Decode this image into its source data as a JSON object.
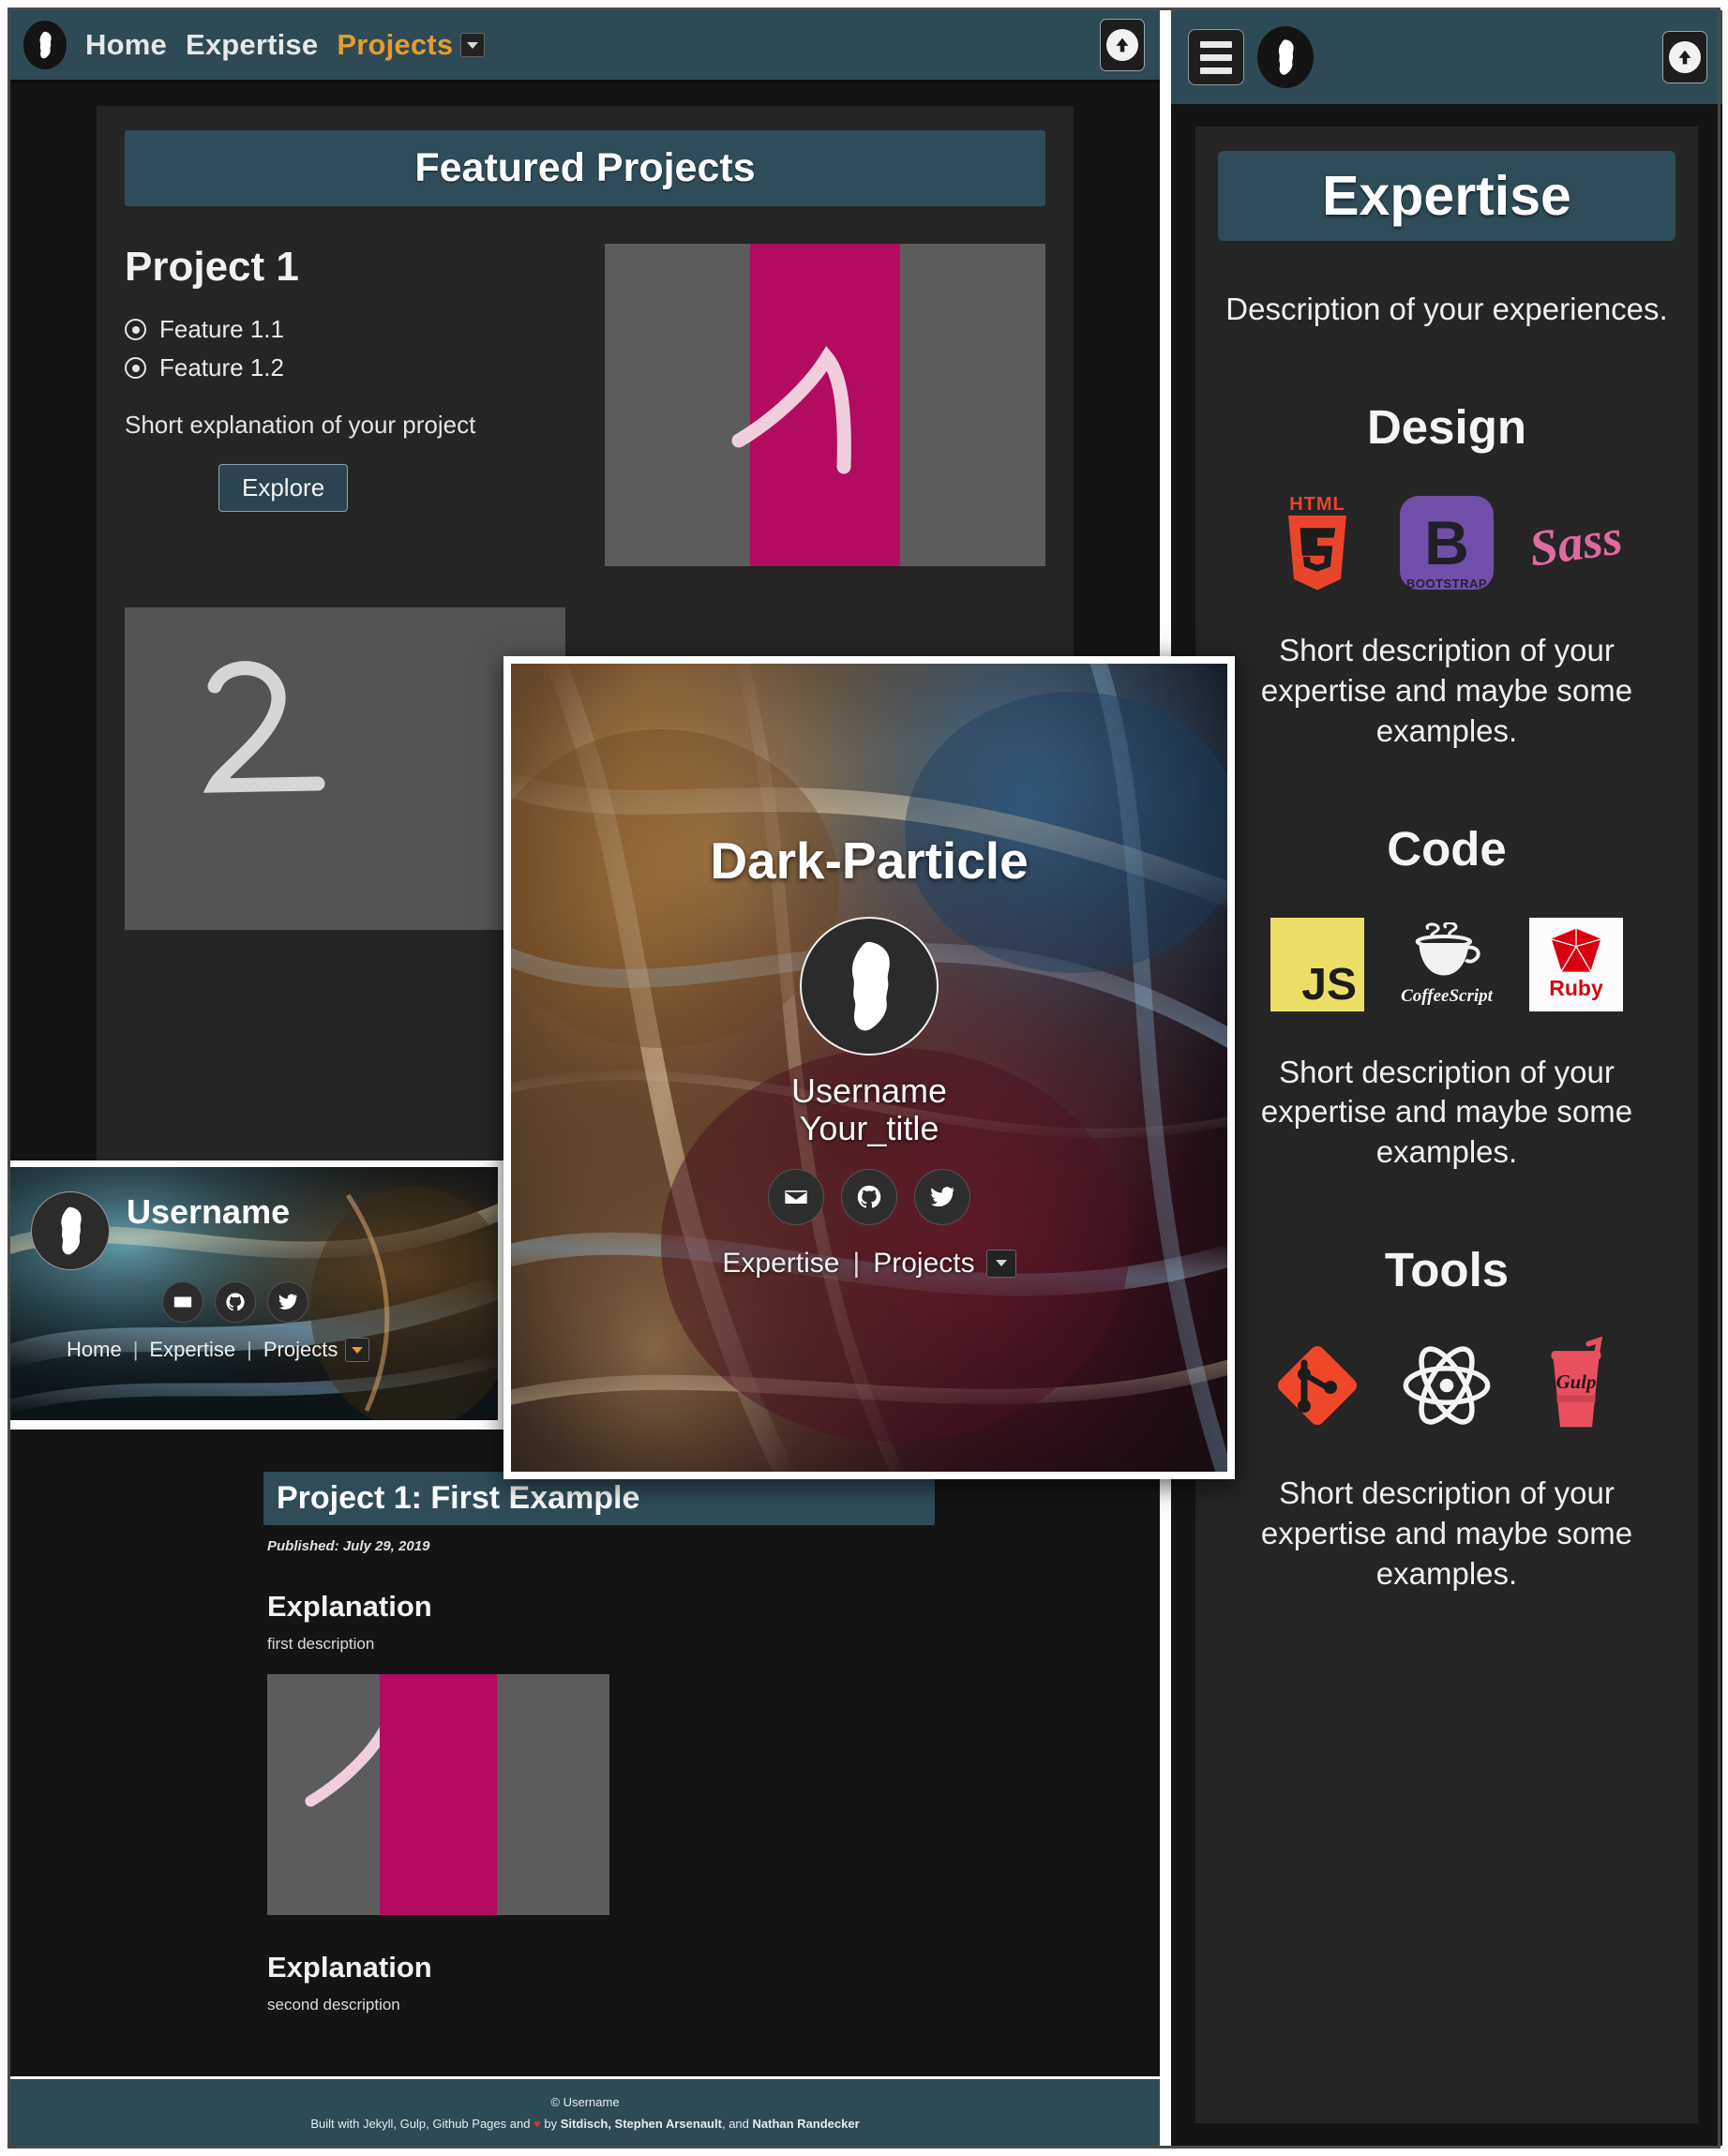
{
  "left_panel": {
    "nav": {
      "brand_icon": "avatar-blob-icon",
      "items": [
        {
          "label": "Home",
          "active": false
        },
        {
          "label": "Expertise",
          "active": false
        },
        {
          "label": "Projects",
          "active": true
        }
      ],
      "projects_caret": "chevron-down-icon",
      "scroll_top_icon": "arrow-up-icon"
    },
    "banner": "Featured Projects",
    "project": {
      "title": "Project 1",
      "features": [
        "Feature 1.1",
        "Feature 1.2"
      ],
      "description": "Short explanation of your project",
      "explore_label": "Explore",
      "thumb_digit": "1",
      "thumb_band_color": "#b30b5f"
    },
    "project2": {
      "thumb_digit": "2"
    }
  },
  "mobile_card": {
    "username": "Username",
    "socials": [
      "email-icon",
      "github-icon",
      "twitter-icon"
    ],
    "nav": [
      "Home",
      "Expertise",
      "Projects"
    ],
    "caret": "chevron-down-icon"
  },
  "modal": {
    "title": "Dark-Particle",
    "avatar_icon": "avatar-blob-icon",
    "username": "Username",
    "subtitle": "Your_title",
    "socials": [
      "email-icon",
      "github-icon",
      "twitter-icon"
    ],
    "nav": [
      "Expertise",
      "Projects"
    ],
    "caret": "chevron-down-icon"
  },
  "post_panel": {
    "banner": "Project 1: First Example",
    "published": "Published: July 29, 2019",
    "sections": [
      {
        "heading": "Explanation",
        "body": "first description"
      },
      {
        "heading": "Explanation",
        "body": "second description"
      }
    ],
    "thumb_digit": "1"
  },
  "footer": {
    "copyright": "© Username",
    "credit_prefix": "Built with Jekyll, Gulp, Github Pages and",
    "heart": "♥",
    "credit_by": "by",
    "credit_names_1": "Sitdisch, Stephen Arsenault",
    "credit_and": "and",
    "credit_names_2": "Nathan Randecker"
  },
  "right_panel": {
    "nav": {
      "menu_icon": "hamburger-menu-icon",
      "brand_icon": "avatar-blob-icon",
      "scroll_top_icon": "arrow-up-icon"
    },
    "banner": "Expertise",
    "description": "Description of your experiences.",
    "sections": [
      {
        "heading": "Design",
        "icons": [
          "html5-icon",
          "bootstrap-icon",
          "sass-icon"
        ],
        "icon_labels": [
          "HTML",
          "B",
          "BOOTSTRAP",
          "Sass"
        ],
        "body": "Short description of your expertise and maybe some examples."
      },
      {
        "heading": "Code",
        "icons": [
          "javascript-icon",
          "coffeescript-icon",
          "ruby-icon"
        ],
        "icon_labels": [
          "JS",
          "CoffeeScript",
          "Ruby"
        ],
        "body": "Short description of your expertise and maybe some examples."
      },
      {
        "heading": "Tools",
        "icons": [
          "git-icon",
          "atom-icon",
          "gulp-icon"
        ],
        "icon_labels": [
          "Gulp"
        ],
        "body": "Short description of your expertise and maybe some examples."
      }
    ]
  },
  "colors": {
    "accent_teal": "#2e4b55",
    "accent_orange": "#e89b2c",
    "panel_dark": "#141414",
    "card_dark": "#252525",
    "magenta": "#b30b5f"
  }
}
